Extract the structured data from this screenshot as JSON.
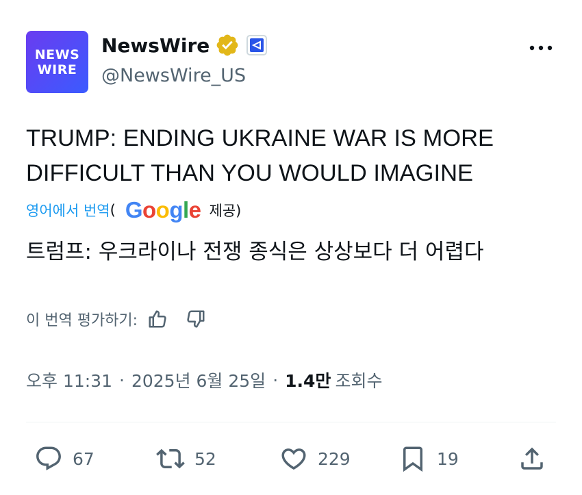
{
  "account": {
    "avatar_line1": "NEWS",
    "avatar_line2": "WIRE",
    "display_name": "NewsWire",
    "handle": "@NewsWire_US"
  },
  "tweet": {
    "text": "TRUMP: ENDING UKRAINE WAR IS MORE DIFFICULT THAN YOU WOULD IMAGINE",
    "translate_label": "영어에서 번역",
    "paren_open": "(",
    "google": "Google",
    "provided_by": "제공)",
    "translated_text": "트럼프: 우크라이나 전쟁 종식은 상상보다 더 어렵다",
    "rate_label": "이 번역 평가하기:"
  },
  "meta": {
    "time": "오후 11:31",
    "separator": "·",
    "date": "2025년 6월 25일",
    "views_count": "1.4만",
    "views_label": "조회수"
  },
  "actions": {
    "replies": "67",
    "reposts": "52",
    "likes": "229",
    "bookmarks": "19"
  },
  "icons": [
    "verified-gold-icon",
    "affiliate-badge-icon",
    "more-icon",
    "thumbs-up-icon",
    "thumbs-down-icon",
    "reply-icon",
    "repost-icon",
    "like-icon",
    "bookmark-icon",
    "share-icon"
  ],
  "colors": {
    "link": "#1d9bf0",
    "secondary_text": "#536471",
    "verified_gold": "#e2b719",
    "avatar_gradient": [
      "#6a3cf0",
      "#3b5bff"
    ]
  }
}
